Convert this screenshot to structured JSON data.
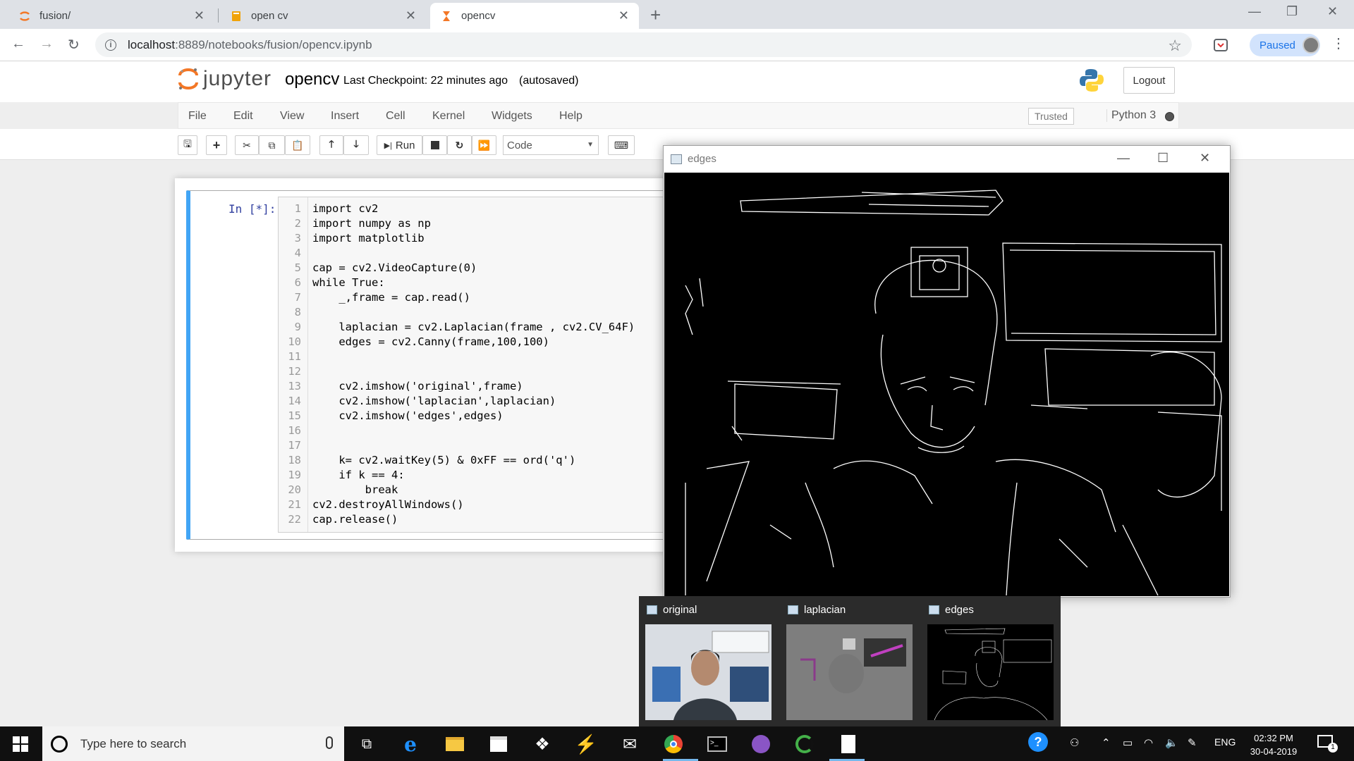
{
  "browser": {
    "tabs": [
      {
        "title": "fusion/",
        "active": false
      },
      {
        "title": "open cv",
        "active": false
      },
      {
        "title": "opencv",
        "active": true
      }
    ],
    "url_host": "localhost",
    "url_path": ":8889/notebooks/fusion/opencv.ipynb",
    "profile_status": "Paused"
  },
  "jupyter": {
    "logo_text": "jupyter",
    "notebook_name": "opencv",
    "checkpoint": "Last Checkpoint: 22 minutes ago",
    "autosave": "(autosaved)",
    "logout_label": "Logout",
    "menu": [
      "File",
      "Edit",
      "View",
      "Insert",
      "Cell",
      "Kernel",
      "Widgets",
      "Help"
    ],
    "trusted_label": "Trusted",
    "kernel_name": "Python 3",
    "run_label": "Run",
    "cell_type": "Code",
    "prompt": "In [*]:",
    "code_lines": [
      "import cv2",
      "import numpy as np",
      "import matplotlib",
      "",
      "cap = cv2.VideoCapture(0)",
      "while True:",
      "    _,frame = cap.read()",
      "",
      "    laplacian = cv2.Laplacian(frame , cv2.CV_64F)",
      "    edges = cv2.Canny(frame,100,100)",
      "",
      "",
      "    cv2.imshow('original',frame)",
      "    cv2.imshow('laplacian',laplacian)",
      "    cv2.imshow('edges',edges)",
      "",
      "",
      "    k= cv2.waitKey(5) & 0xFF == ord('q')",
      "    if k == 4:",
      "        break",
      "cv2.destroyAllWindows()",
      "cap.release()"
    ]
  },
  "cv_window": {
    "title": "edges"
  },
  "thumbnails": [
    {
      "label": "original"
    },
    {
      "label": "laplacian"
    },
    {
      "label": "edges"
    }
  ],
  "taskbar": {
    "search_placeholder": "Type here to search",
    "language": "ENG",
    "time": "02:32 PM",
    "date": "30-04-2019",
    "notification_count": "1"
  }
}
